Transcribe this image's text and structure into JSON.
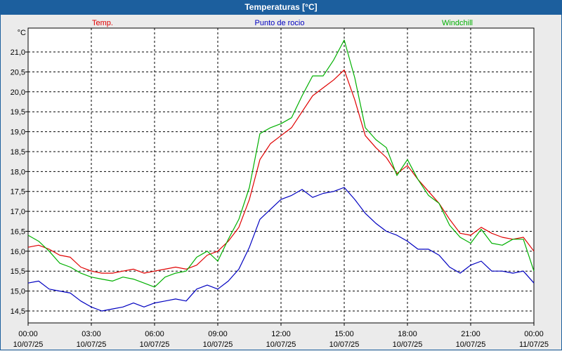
{
  "window": {
    "title": "Temperaturas [°C]"
  },
  "colors": {
    "titlebar": "#1c5f9e",
    "background": "#ebebeb",
    "plot": "#ffffff"
  },
  "chart_data": {
    "type": "line",
    "title": "Temperaturas [°C]",
    "ylabel": "°C",
    "ylim": [
      14.2,
      21.6
    ],
    "grid": true,
    "legend_position": "top",
    "y_ticks": [
      "14,5",
      "15,0",
      "15,5",
      "16,0",
      "16,5",
      "17,0",
      "17,5",
      "18,0",
      "18,5",
      "19,0",
      "19,5",
      "20,0",
      "20,5",
      "21,0"
    ],
    "x_ticks": [
      {
        "time": "00:00",
        "date": "10/07/25"
      },
      {
        "time": "03:00",
        "date": "10/07/25"
      },
      {
        "time": "06:00",
        "date": "10/07/25"
      },
      {
        "time": "09:00",
        "date": "10/07/25"
      },
      {
        "time": "12:00",
        "date": "10/07/25"
      },
      {
        "time": "15:00",
        "date": "10/07/25"
      },
      {
        "time": "18:00",
        "date": "10/07/25"
      },
      {
        "time": "21:00",
        "date": "10/07/25"
      },
      {
        "time": "00:00",
        "date": "11/07/25"
      }
    ],
    "series": [
      {
        "name": "Temp.",
        "color": "#e00000",
        "points": [
          [
            "00:00",
            16.1
          ],
          [
            "00:30",
            16.15
          ],
          [
            "01:00",
            16.05
          ],
          [
            "01:30",
            15.9
          ],
          [
            "02:00",
            15.85
          ],
          [
            "02:30",
            15.6
          ],
          [
            "03:00",
            15.5
          ],
          [
            "03:30",
            15.45
          ],
          [
            "04:00",
            15.45
          ],
          [
            "04:30",
            15.5
          ],
          [
            "05:00",
            15.55
          ],
          [
            "05:30",
            15.45
          ],
          [
            "06:00",
            15.5
          ],
          [
            "06:30",
            15.55
          ],
          [
            "07:00",
            15.6
          ],
          [
            "07:30",
            15.55
          ],
          [
            "08:00",
            15.65
          ],
          [
            "08:30",
            15.9
          ],
          [
            "09:00",
            16.0
          ],
          [
            "09:30",
            16.25
          ],
          [
            "10:00",
            16.6
          ],
          [
            "10:30",
            17.3
          ],
          [
            "11:00",
            18.3
          ],
          [
            "11:30",
            18.7
          ],
          [
            "12:00",
            18.9
          ],
          [
            "12:30",
            19.1
          ],
          [
            "13:00",
            19.5
          ],
          [
            "13:30",
            19.9
          ],
          [
            "14:00",
            20.1
          ],
          [
            "14:30",
            20.3
          ],
          [
            "15:00",
            20.55
          ],
          [
            "15:30",
            19.8
          ],
          [
            "16:00",
            18.9
          ],
          [
            "16:30",
            18.6
          ],
          [
            "17:00",
            18.35
          ],
          [
            "17:30",
            17.95
          ],
          [
            "18:00",
            18.15
          ],
          [
            "18:30",
            17.8
          ],
          [
            "19:00",
            17.5
          ],
          [
            "19:30",
            17.2
          ],
          [
            "20:00",
            16.8
          ],
          [
            "20:30",
            16.45
          ],
          [
            "21:00",
            16.4
          ],
          [
            "21:30",
            16.6
          ],
          [
            "22:00",
            16.45
          ],
          [
            "22:30",
            16.35
          ],
          [
            "23:00",
            16.3
          ],
          [
            "23:30",
            16.35
          ],
          [
            "24:00",
            16.0
          ]
        ]
      },
      {
        "name": "Punto de rocio",
        "color": "#0000c0",
        "points": [
          [
            "00:00",
            15.2
          ],
          [
            "00:30",
            15.25
          ],
          [
            "01:00",
            15.05
          ],
          [
            "01:30",
            15.0
          ],
          [
            "02:00",
            14.95
          ],
          [
            "02:30",
            14.75
          ],
          [
            "03:00",
            14.6
          ],
          [
            "03:30",
            14.5
          ],
          [
            "04:00",
            14.55
          ],
          [
            "04:30",
            14.6
          ],
          [
            "05:00",
            14.7
          ],
          [
            "05:30",
            14.6
          ],
          [
            "06:00",
            14.7
          ],
          [
            "06:30",
            14.75
          ],
          [
            "07:00",
            14.8
          ],
          [
            "07:30",
            14.75
          ],
          [
            "08:00",
            15.05
          ],
          [
            "08:30",
            15.15
          ],
          [
            "09:00",
            15.05
          ],
          [
            "09:30",
            15.25
          ],
          [
            "10:00",
            15.55
          ],
          [
            "10:30",
            16.1
          ],
          [
            "11:00",
            16.8
          ],
          [
            "11:30",
            17.05
          ],
          [
            "12:00",
            17.3
          ],
          [
            "12:30",
            17.4
          ],
          [
            "13:00",
            17.55
          ],
          [
            "13:30",
            17.35
          ],
          [
            "14:00",
            17.45
          ],
          [
            "14:30",
            17.5
          ],
          [
            "15:00",
            17.6
          ],
          [
            "15:30",
            17.3
          ],
          [
            "16:00",
            16.95
          ],
          [
            "16:30",
            16.7
          ],
          [
            "17:00",
            16.5
          ],
          [
            "17:30",
            16.4
          ],
          [
            "18:00",
            16.25
          ],
          [
            "18:30",
            16.05
          ],
          [
            "19:00",
            16.05
          ],
          [
            "19:30",
            15.9
          ],
          [
            "20:00",
            15.6
          ],
          [
            "20:30",
            15.45
          ],
          [
            "21:00",
            15.65
          ],
          [
            "21:30",
            15.75
          ],
          [
            "22:00",
            15.5
          ],
          [
            "22:30",
            15.5
          ],
          [
            "23:00",
            15.45
          ],
          [
            "23:30",
            15.5
          ],
          [
            "24:00",
            15.2
          ]
        ]
      },
      {
        "name": "Windchill",
        "color": "#00b000",
        "points": [
          [
            "00:00",
            16.4
          ],
          [
            "00:30",
            16.25
          ],
          [
            "01:00",
            16.0
          ],
          [
            "01:30",
            15.7
          ],
          [
            "02:00",
            15.6
          ],
          [
            "02:30",
            15.45
          ],
          [
            "03:00",
            15.35
          ],
          [
            "03:30",
            15.3
          ],
          [
            "04:00",
            15.25
          ],
          [
            "04:30",
            15.35
          ],
          [
            "05:00",
            15.3
          ],
          [
            "05:30",
            15.2
          ],
          [
            "06:00",
            15.1
          ],
          [
            "06:30",
            15.35
          ],
          [
            "07:00",
            15.45
          ],
          [
            "07:30",
            15.5
          ],
          [
            "08:00",
            15.85
          ],
          [
            "08:30",
            16.0
          ],
          [
            "09:00",
            15.75
          ],
          [
            "09:30",
            16.3
          ],
          [
            "10:00",
            16.8
          ],
          [
            "10:30",
            17.6
          ],
          [
            "11:00",
            18.95
          ],
          [
            "11:30",
            19.1
          ],
          [
            "12:00",
            19.2
          ],
          [
            "12:30",
            19.35
          ],
          [
            "13:00",
            19.9
          ],
          [
            "13:30",
            20.4
          ],
          [
            "14:00",
            20.4
          ],
          [
            "14:30",
            20.8
          ],
          [
            "15:00",
            21.3
          ],
          [
            "15:30",
            20.35
          ],
          [
            "16:00",
            19.1
          ],
          [
            "16:30",
            18.8
          ],
          [
            "17:00",
            18.6
          ],
          [
            "17:30",
            17.9
          ],
          [
            "18:00",
            18.3
          ],
          [
            "18:30",
            17.8
          ],
          [
            "19:00",
            17.4
          ],
          [
            "19:30",
            17.2
          ],
          [
            "20:00",
            16.65
          ],
          [
            "20:30",
            16.35
          ],
          [
            "21:00",
            16.2
          ],
          [
            "21:30",
            16.55
          ],
          [
            "22:00",
            16.2
          ],
          [
            "22:30",
            16.15
          ],
          [
            "23:00",
            16.3
          ],
          [
            "23:30",
            16.3
          ],
          [
            "24:00",
            15.5
          ]
        ]
      }
    ]
  }
}
